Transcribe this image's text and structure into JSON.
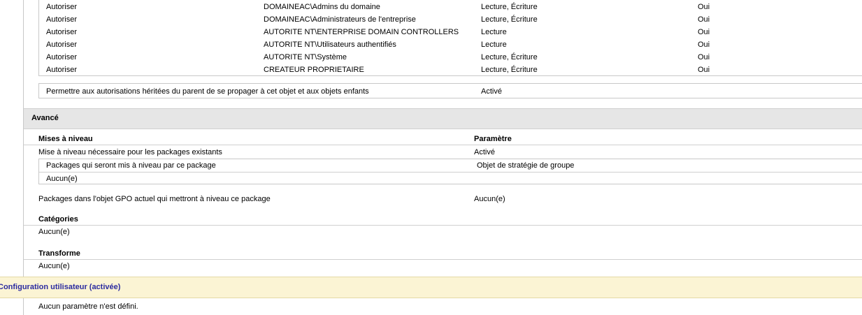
{
  "permissions": {
    "rows": [
      {
        "type": "Autoriser",
        "name": "DOMAINEAC\\Admins du domaine",
        "perms": "Lecture, Écriture",
        "inherited": "Oui"
      },
      {
        "type": "Autoriser",
        "name": "DOMAINEAC\\Administrateurs de l'entreprise",
        "perms": "Lecture, Écriture",
        "inherited": "Oui"
      },
      {
        "type": "Autoriser",
        "name": "AUTORITE NT\\ENTERPRISE DOMAIN CONTROLLERS",
        "perms": "Lecture",
        "inherited": "Oui"
      },
      {
        "type": "Autoriser",
        "name": "AUTORITE NT\\Utilisateurs authentifiés",
        "perms": "Lecture",
        "inherited": "Oui"
      },
      {
        "type": "Autoriser",
        "name": "AUTORITE NT\\Système",
        "perms": "Lecture, Écriture",
        "inherited": "Oui"
      },
      {
        "type": "Autoriser",
        "name": "CREATEUR PROPRIETAIRE",
        "perms": "Lecture, Écriture",
        "inherited": "Oui"
      }
    ],
    "inherit_label": "Permettre aux autorisations héritées du parent de se propager à cet objet et aux objets enfants",
    "inherit_value": "Activé"
  },
  "advanced": {
    "title": "Avancé",
    "upgrades_header": "Mises à niveau",
    "param_header": "Paramètre",
    "upgrade_required_label": "Mise à niveau nécessaire pour les packages existants",
    "upgrade_required_value": "Activé",
    "packages_upgraded_label": "Packages qui seront mis à niveau par ce package",
    "packages_upgraded_header": "Objet de stratégie de groupe",
    "packages_upgraded_value": "Aucun(e)",
    "packages_in_gpo_label": "Packages dans l'objet GPO actuel qui mettront à niveau ce package",
    "packages_in_gpo_value": "Aucun(e)",
    "categories_header": "Catégories",
    "categories_value": "Aucun(e)",
    "transform_header": "Transforme",
    "transform_value": "Aucun(e)"
  },
  "user_config": {
    "title": "Configuration utilisateur (activée)",
    "empty_text": "Aucun paramètre n'est défini."
  }
}
